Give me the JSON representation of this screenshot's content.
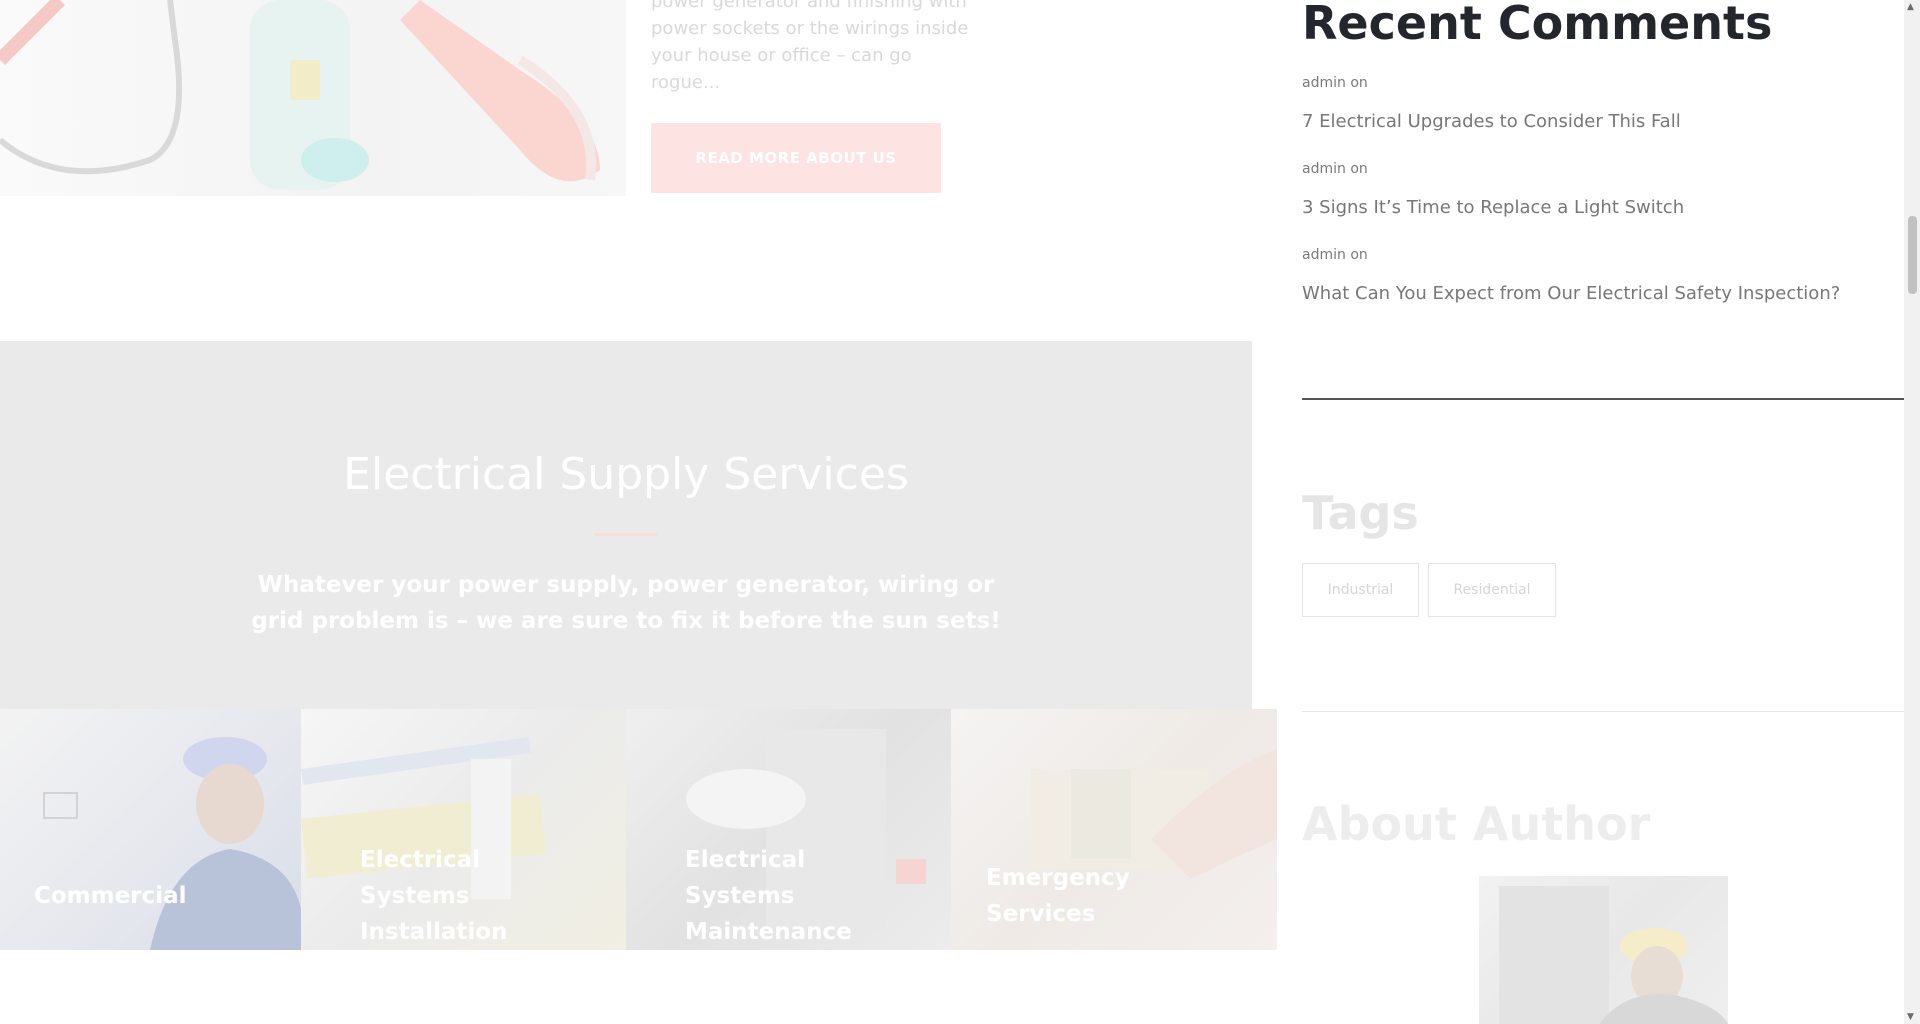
{
  "about": {
    "text_lines": [
      "power generator and finishing with",
      "power sockets or the wirings inside",
      "your house or office – can go rogue..."
    ],
    "button_label": "READ MORE ABOUT US"
  },
  "services": {
    "title": "Electrical Supply Services",
    "subtitle": "Whatever your power supply, power generator, wiring or grid problem is – we are sure to fix it before the sun sets!",
    "cards": [
      {
        "title": "Commercial"
      },
      {
        "title": "Electrical Systems Installation"
      },
      {
        "title": "Electrical Systems Maintenance"
      },
      {
        "title": "Emergency Services"
      }
    ]
  },
  "sidebar": {
    "recent_comments": {
      "title": "Recent Comments",
      "items": [
        {
          "meta": "admin on",
          "link": "7 Electrical Upgrades to Consider This Fall"
        },
        {
          "meta": "admin on",
          "link": "3 Signs It’s Time to Replace a Light Switch"
        },
        {
          "meta": "admin on",
          "link": "What Can You Expect from Our Electrical Safety Inspection?"
        }
      ]
    },
    "tags": {
      "title": "Tags",
      "items": [
        "Industrial",
        "Residential"
      ]
    },
    "about_author": {
      "title": "About Author"
    }
  },
  "colors": {
    "accent": "#fde3e1",
    "banner_bg": "#eaeaea",
    "heading_dark": "#23262d"
  },
  "icons": {
    "scroll_up": "triangle-up-icon",
    "scroll_down": "triangle-down-icon"
  }
}
